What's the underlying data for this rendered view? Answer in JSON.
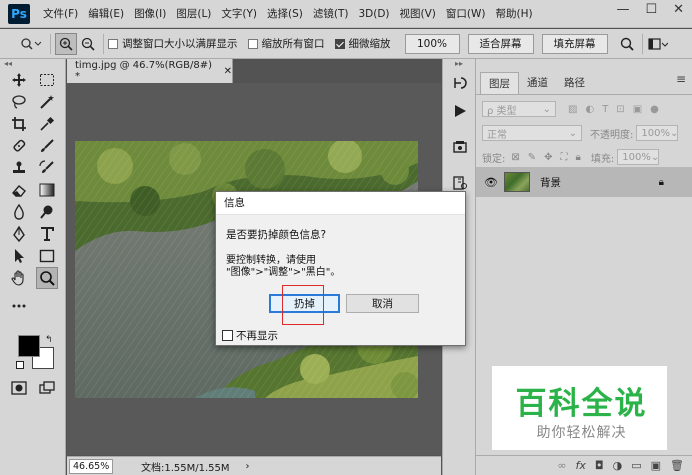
{
  "app": {
    "logo": "Ps",
    "menu": [
      "文件(F)",
      "编辑(E)",
      "图像(I)",
      "图层(L)",
      "文字(Y)",
      "选择(S)",
      "滤镜(T)",
      "3D(D)",
      "视图(V)",
      "窗口(W)",
      "帮助(H)"
    ],
    "window_controls": {
      "minimize": "—",
      "restore": "☐",
      "close": "✕"
    }
  },
  "options": {
    "resize_windows": "调整窗口大小以满屏显示",
    "zoom_all": "缩放所有窗口",
    "scrubby_zoom": "细微缩放",
    "zoom_button": "100%",
    "fit_screen": "适合屏幕",
    "fill_screen": "填充屏幕"
  },
  "document": {
    "tab_title": "timg.jpg @ 46.7%(RGB/8#) *",
    "zoom": "46.65%",
    "doc_size": "文档:1.55M/1.55M",
    "arrow": "›"
  },
  "layers_panel": {
    "tabs": [
      "图层",
      "通道",
      "路径"
    ],
    "active_tab": 0,
    "kind_filter": "ρ 类型",
    "blend_mode": "正常",
    "opacity_label": "不透明度:",
    "opacity_value": "100%",
    "lock_label": "锁定:",
    "fill_label": "填充:",
    "fill_value": "100%",
    "layer_name": "背景"
  },
  "dialog": {
    "title": "信息",
    "question": "是否要扔掉颜色信息?",
    "message_line1": "要控制转换，请使用",
    "message_line2": "\"图像\">\"调整\">\"黑白\"。",
    "discard_button": "扔掉",
    "cancel_button": "取消",
    "dont_show": "不再显示"
  },
  "watermark": {
    "title": "百科全说",
    "subtitle": "助你轻松解决"
  },
  "colors": {
    "ui_gray": "#d6d6d6",
    "canvas_bg": "#595959",
    "ps_blue": "#31a8ff",
    "highlight_red": "#e02a2a",
    "dialog_accent": "#2b79d8",
    "watermark_green": "#2bb34a"
  }
}
